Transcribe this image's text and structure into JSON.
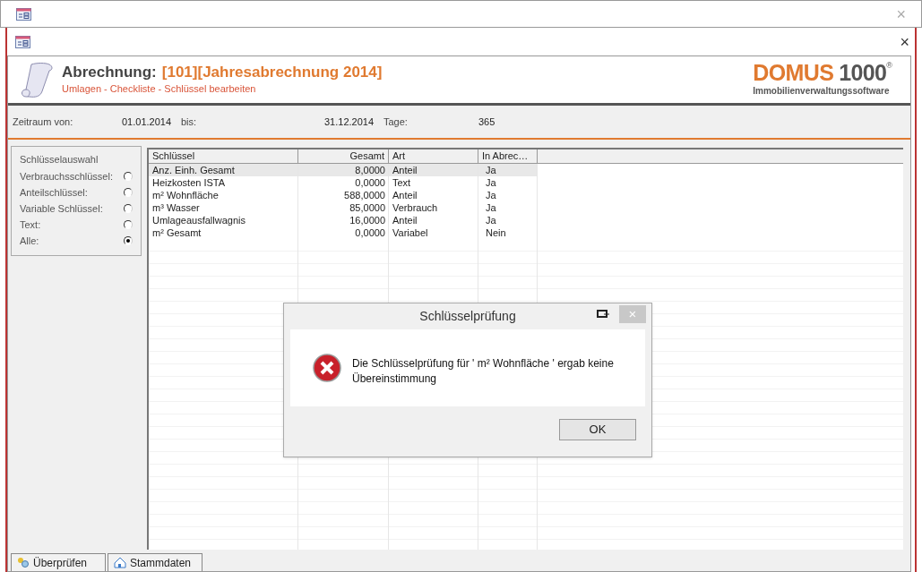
{
  "outer_window": {
    "close": "×"
  },
  "inner_window": {
    "close": "×"
  },
  "header": {
    "title": "Abrechnung:",
    "record": "[101][Jahresabrechnung 2014]",
    "subtitle": "Umlagen - Checkliste - Schlüssel bearbeiten",
    "logo_word": "DOMUS",
    "logo_number": "1000",
    "logo_mark": "®",
    "logo_tagline": "Immobilienverwaltungssoftware"
  },
  "period": {
    "from_label": "Zeitraum von:",
    "from": "01.01.2014",
    "to_label": "bis:",
    "to": "31.12.2014",
    "days_label": "Tage:",
    "days": "365"
  },
  "key_filter": {
    "title": "Schlüsselauswahl",
    "options": [
      {
        "label": "Verbrauchsschlüssel:",
        "selected": false
      },
      {
        "label": "Anteilschlüssel:",
        "selected": false
      },
      {
        "label": "Variable Schlüssel:",
        "selected": false
      },
      {
        "label": "Text:",
        "selected": false
      },
      {
        "label": "Alle:",
        "selected": true
      }
    ]
  },
  "table": {
    "columns": [
      "Schlüssel",
      "Gesamt",
      "Art",
      "In Abrec…"
    ],
    "rows": [
      {
        "cells": [
          "Anz. Einh. Gesamt",
          "8,0000",
          "Anteil",
          "Ja"
        ],
        "selected": true
      },
      {
        "cells": [
          "Heizkosten ISTA",
          "0,0000",
          "Text",
          "Ja"
        ],
        "selected": false
      },
      {
        "cells": [
          "m² Wohnfläche",
          "588,0000",
          "Anteil",
          "Ja"
        ],
        "selected": false
      },
      {
        "cells": [
          "m³ Wasser",
          "85,0000",
          "Verbrauch",
          "Ja"
        ],
        "selected": false
      },
      {
        "cells": [
          "Umlageausfallwagnis",
          "16,0000",
          "Anteil",
          "Ja"
        ],
        "selected": false
      },
      {
        "cells": [
          "m² Gesamt",
          "0,0000",
          "Variabel",
          "Nein"
        ],
        "selected": false
      }
    ]
  },
  "dialog": {
    "title": "Schlüsselprüfung",
    "close": "×",
    "message": "Die Schlüsselprüfung für ' m² Wohnfläche ' ergab keine Übereinstimmung",
    "button": "OK"
  },
  "tabs": [
    {
      "label": "Überprüfen"
    },
    {
      "label": "Stammdaten"
    }
  ]
}
